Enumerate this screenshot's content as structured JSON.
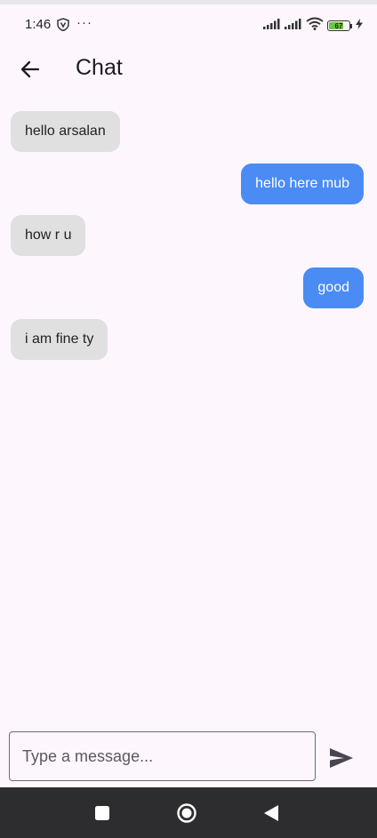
{
  "status_bar": {
    "time": "1:46",
    "more": "···",
    "battery": "67",
    "icons": [
      "vpn-shield-icon",
      "signal-icon",
      "signal-icon",
      "wifi-icon",
      "battery-icon",
      "charging-icon"
    ]
  },
  "app_bar": {
    "title": "Chat",
    "back_icon": "arrow-left-icon"
  },
  "messages": [
    {
      "text": "hello arsalan",
      "direction": "received"
    },
    {
      "text": "hello here mub",
      "direction": "sent"
    },
    {
      "text": "how r u",
      "direction": "received"
    },
    {
      "text": "good",
      "direction": "sent"
    },
    {
      "text": "i am fine ty",
      "direction": "received"
    }
  ],
  "composer": {
    "placeholder": "Type a message...",
    "value": "",
    "send_icon": "send-icon"
  },
  "nav_bar": {
    "icons": [
      "recents-square-icon",
      "home-circle-icon",
      "back-triangle-icon"
    ]
  },
  "colors": {
    "background": "#fdf7fd",
    "sent_bubble": "#4a8cf4",
    "received_bubble": "#e0e0e0",
    "nav_bar": "#2d2d2f"
  }
}
